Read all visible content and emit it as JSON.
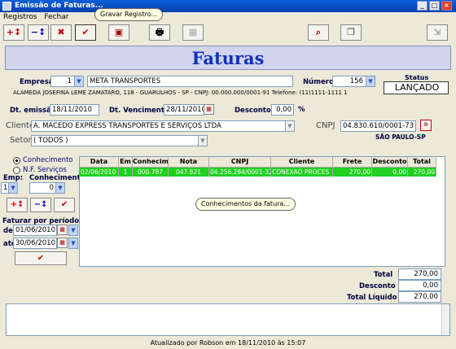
{
  "window": {
    "title": "Emissão de Faturas..."
  },
  "menu": [
    "Registros",
    "Fechar"
  ],
  "tooltips": {
    "save": "Gravar Registro...",
    "grid": "Conhecimentos da fatura..."
  },
  "header": {
    "title": "Faturas"
  },
  "empresa": {
    "label": "Empresa",
    "code": "1",
    "name": "META TRANSPORTES",
    "address": "ALAMEDA JOSEFINA LEME ZAMATARO, 118 - GUARULHOS - SP - CNPJ: 00.000.000/0001-91 Telefone: (11)1111-1111 1"
  },
  "numero": {
    "label": "Número",
    "value": "156"
  },
  "status": {
    "label": "Status",
    "value": "LANÇADO"
  },
  "dates": {
    "emissao_label": "Dt. emissão:",
    "emissao": "18/11/2010",
    "vencimento_label": "Dt. Vencimento:",
    "vencimento": "28/11/2010",
    "desconto_label": "Desconto:",
    "desconto": "0,00",
    "pct": "%"
  },
  "cliente": {
    "label": "Cliente",
    "value": "A. MACEDO EXPRESS TRANSPORTES E SERVIÇOS LTDA",
    "cnpj_label": "CNPJ",
    "cnpj": "04.830.610/0001-73",
    "city": "SÃO PAULO-SP"
  },
  "setor": {
    "label": "Setor",
    "value": "( TODOS )"
  },
  "side": {
    "opt1": "Conhecimento",
    "opt2": "N.F. Serviços",
    "emp_label": "Emp:",
    "emp": "1",
    "conh_label": "Conhecimento:",
    "conh": "0",
    "periodo": "Faturar por período:",
    "de_label": "de:",
    "de": "01/06/2010",
    "ate_label": "até:",
    "ate": "30/06/2010"
  },
  "grid": {
    "columns": [
      "Data",
      "Em",
      "Conhecim",
      "Nota Fiscal",
      "CNPJ",
      "Cliente",
      "Frete",
      "Desconto",
      "Total"
    ],
    "rows": [
      [
        "02/06/2010",
        "1",
        "000.787",
        "047.821",
        "04.256.284/0001-32",
        "CONEXAO PROCES",
        "270,00",
        "0,00",
        "270,00"
      ]
    ]
  },
  "totals": {
    "total_label": "Total",
    "total": "270,00",
    "desconto_label": "Desconto",
    "desconto": "0,00",
    "liquido_label": "Total Líquido",
    "liquido": "270,00"
  },
  "status_bar": "Atualizado por Robson em 18/11/2010 às 15:07",
  "colors": {
    "grid_row": "#1fd01f",
    "title": "#1230c0",
    "banner": "#d0d4ec"
  }
}
